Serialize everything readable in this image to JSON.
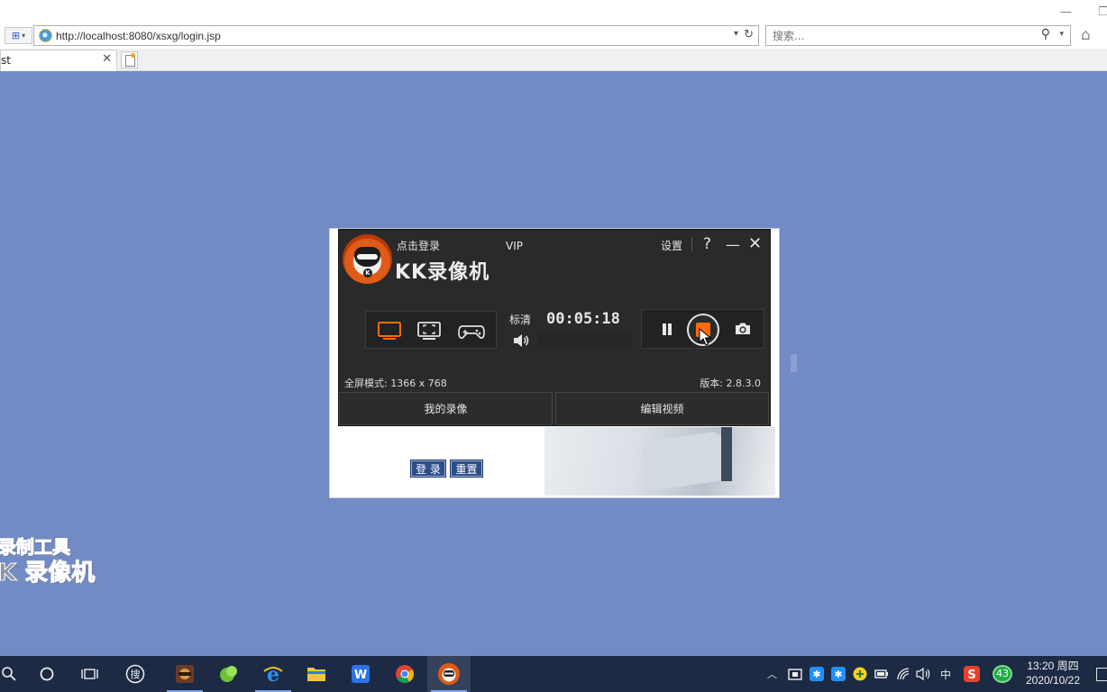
{
  "browser": {
    "url": "http://localhost:8080/xsxg/login.jsp",
    "search_placeholder": "搜索...",
    "tab_title": "st",
    "window_minimize": "—",
    "window_restore": "❐"
  },
  "page": {
    "login_button": "登 录",
    "reset_button": "重置"
  },
  "kk_recorder": {
    "login_link": "点击登录",
    "vip": "VIP",
    "app_title": "KK录像机",
    "settings": "设置",
    "help": "?",
    "quality": "标清",
    "timer": "00:05:18",
    "fullscreen_info": "全屏模式: 1366 x 768",
    "version": "版本: 2.8.3.0",
    "my_recordings": "我的录像",
    "edit_video": "编辑视频",
    "accent_color": "#ff6a0a",
    "logo_letter": "K"
  },
  "watermark": {
    "line1": "录制工具",
    "line2": "K 录像机"
  },
  "taskbar": {
    "tray_input_lang": "中",
    "tray_badge": "43",
    "time": "13:20 周四",
    "date": "2020/10/22"
  }
}
